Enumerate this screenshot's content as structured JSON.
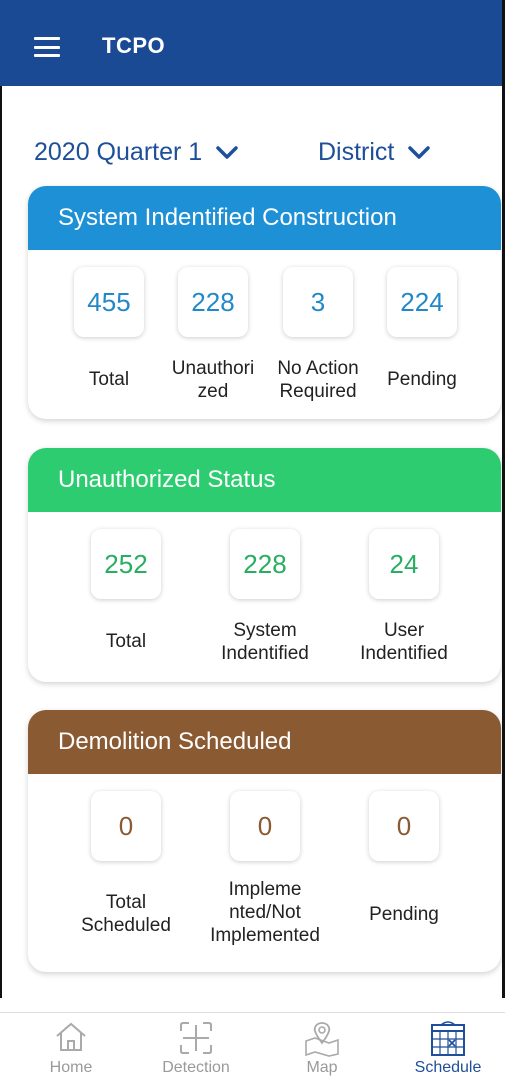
{
  "app": {
    "title": "TCPO"
  },
  "filters": {
    "quarter": "2020 Quarter 1",
    "district": "District"
  },
  "colors": {
    "appbar": "#1b4a94",
    "card1": "#1e90d6",
    "card2": "#2ecc71",
    "card3": "#8a5a33",
    "value1": "#2388c9",
    "value2": "#27ae60",
    "value3": "#8a5a33"
  },
  "cards": [
    {
      "title": "System Indentified Construction",
      "stats": [
        {
          "value": "455",
          "label": "Total"
        },
        {
          "value": "228",
          "label": "Unauthori\nzed"
        },
        {
          "value": "3",
          "label": "No Action\nRequired"
        },
        {
          "value": "224",
          "label": "Pending"
        }
      ]
    },
    {
      "title": "Unauthorized Status",
      "stats": [
        {
          "value": "252",
          "label": "Total"
        },
        {
          "value": "228",
          "label": "System\nIndentified"
        },
        {
          "value": "24",
          "label": "User\nIndentified"
        }
      ]
    },
    {
      "title": "Demolition Scheduled",
      "stats": [
        {
          "value": "0",
          "label": "Total\nScheduled"
        },
        {
          "value": "0",
          "label": "Impleme\nnted/Not\nImplemented"
        },
        {
          "value": "0",
          "label": "Pending"
        }
      ]
    }
  ],
  "nav": [
    {
      "label": "Home",
      "icon": "home-icon",
      "active": false
    },
    {
      "label": "Detection",
      "icon": "detection-icon",
      "active": false
    },
    {
      "label": "Map",
      "icon": "map-icon",
      "active": false
    },
    {
      "label": "Schedule",
      "icon": "calendar-icon",
      "active": true
    }
  ]
}
